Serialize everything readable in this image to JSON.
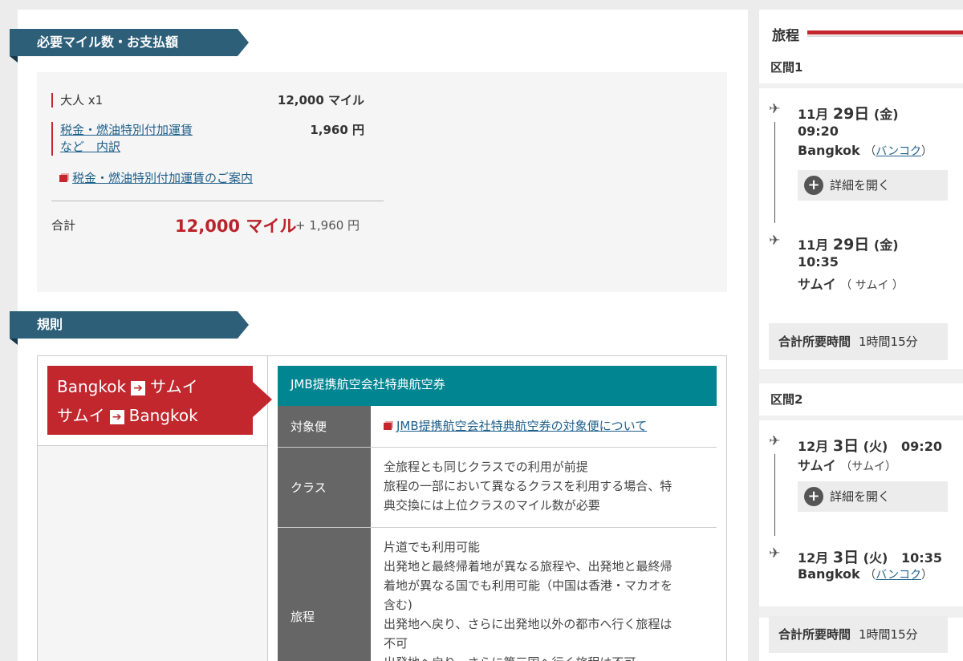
{
  "payment": {
    "title": "必要マイル数・お支払額",
    "adult_label": "大人 x1",
    "adult_miles": "12,000 マイル",
    "tax_link_line1": "税金・燃油特別付加運賃",
    "tax_link_line2": "など　内訳",
    "tax_value": "1,960 円",
    "guide_link": "税金・燃油特別付加運賃のご案内",
    "total_label": "合計",
    "total_miles": "12,000 マイル",
    "total_yen": "+ 1,960 円"
  },
  "rules": {
    "title": "規則",
    "route1_from": "Bangkok",
    "route1_to": "サムイ",
    "route2_from": "サムイ",
    "route2_to": "Bangkok",
    "award_title": "JMB提携航空会社特典航空券",
    "rows": [
      {
        "key": "対象便",
        "link": "JMB提携航空会社特典航空券の対象便について"
      },
      {
        "key": "クラス",
        "lines": [
          "全旅程とも同じクラスでの利用が前提",
          "旅程の一部において異なるクラスを利用する場合、特",
          "典交換には上位クラスのマイル数が必要"
        ]
      },
      {
        "key": "旅程",
        "lines": [
          "片道でも利用可能",
          "出発地と最終帰着地が異なる旅程や、出発地と最終帰",
          "着地が異なる国でも利用可能（中国は香港・マカオを",
          "含む)",
          "出発地へ戻り、さらに出発地以外の都市へ行く旅程は",
          "不可",
          "出発地へ戻り、さらに第三国へ行く旅程は不可"
        ]
      }
    ]
  },
  "itinerary": {
    "title": "旅程",
    "segments": [
      {
        "label": "区間1",
        "dep_date": "11月",
        "dep_day": "29日",
        "dep_wd": "(金)",
        "dep_time": "09:20",
        "dep_city": "Bangkok",
        "dep_city_link": "バンコク",
        "detail_label": "詳細を開く",
        "arr_date": "11月",
        "arr_day": "29日",
        "arr_wd": "(金)",
        "arr_time": "10:35",
        "arr_city": "サムイ",
        "arr_city_sub": "サムイ",
        "duration_label": "合計所要時間",
        "duration": "1時間15分"
      },
      {
        "label": "区間2",
        "dep_date": "12月",
        "dep_day": "3日",
        "dep_wd": "(火)",
        "dep_time": "09:20",
        "dep_city": "サムイ",
        "dep_city_sub": "サムイ",
        "detail_label": "詳細を開く",
        "arr_date": "12月",
        "arr_day": "3日",
        "arr_wd": "(火)",
        "arr_time": "10:35",
        "arr_city": "Bangkok",
        "arr_city_link": "バンコク",
        "duration_label": "合計所要時間",
        "duration": "1時間15分"
      }
    ]
  },
  "colors": {
    "accent_red": "#c1272d",
    "ribbon_blue": "#2d5f79",
    "teal": "#008591"
  }
}
